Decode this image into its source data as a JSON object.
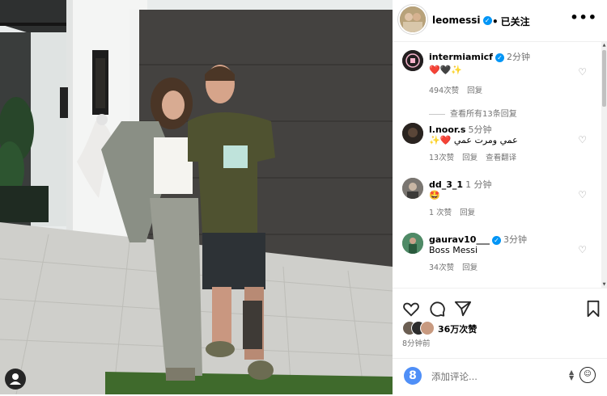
{
  "post": {
    "username": "leomessi",
    "follow_status": "已关注",
    "more_label": "•••",
    "likes": "36万次赞",
    "posted_time": "8分钟前"
  },
  "comments": [
    {
      "username": "intermiamicf",
      "verified": true,
      "time": "2分钟",
      "text": "❤️🖤✨",
      "likes": "494次赞",
      "reply": "回复",
      "view_replies": "查看所有13条回复"
    },
    {
      "username": "l.noor.s",
      "verified": false,
      "time": "5分钟",
      "text": "✨❤️ عمي ومرت عمي",
      "likes": "13次赞",
      "reply": "回复",
      "translate": "查看翻译"
    },
    {
      "username": "dd_3_1",
      "verified": false,
      "time": "1 分钟",
      "text": "🤩",
      "likes": "1 次赞",
      "reply": "回复"
    },
    {
      "username": "gaurav10___",
      "verified": true,
      "time": "3分钟",
      "text": "Boss Messi",
      "likes": "34次赞",
      "reply": "回复"
    }
  ],
  "composer": {
    "placeholder": "添加评论...",
    "avatar_letter": "8",
    "emoji_icon": "smile-icon"
  },
  "icons": [
    "heart-icon",
    "comment-icon",
    "share-icon",
    "bookmark-icon",
    "more-icon"
  ],
  "colors": {
    "verified": "#0095f6",
    "text_secondary": "#737373"
  }
}
